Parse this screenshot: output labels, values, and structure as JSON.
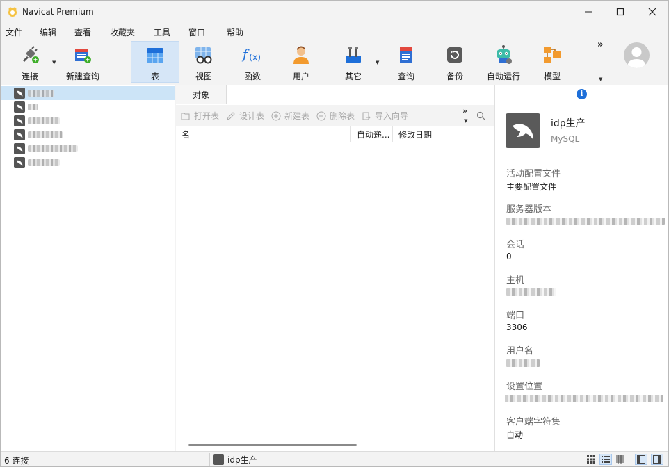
{
  "window": {
    "title": "Navicat Premium",
    "controls": [
      "minimize-icon",
      "maximize-icon",
      "close-icon"
    ]
  },
  "menu": [
    "文件",
    "编辑",
    "查看",
    "收藏夹",
    "工具",
    "窗口",
    "帮助"
  ],
  "toolbar": {
    "buttons": [
      {
        "label": "连接",
        "icon": "connect-plug-icon"
      },
      {
        "label": "新建查询",
        "icon": "new-query-icon"
      },
      {
        "label": "表",
        "icon": "table-icon",
        "active": true
      },
      {
        "label": "视图",
        "icon": "view-glasses-icon"
      },
      {
        "label": "函数",
        "icon": "function-fx-icon"
      },
      {
        "label": "用户",
        "icon": "user-icon"
      },
      {
        "label": "其它",
        "icon": "tools-icon"
      },
      {
        "label": "查询",
        "icon": "query-icon"
      },
      {
        "label": "备份",
        "icon": "backup-icon"
      },
      {
        "label": "自动运行",
        "icon": "robot-icon"
      },
      {
        "label": "模型",
        "icon": "model-icon"
      }
    ],
    "more": "»"
  },
  "sidebar": {
    "connections_count": 6
  },
  "center": {
    "tab_label": "对象",
    "actions": [
      "打开表",
      "设计表",
      "新建表",
      "删除表",
      "导入向导"
    ],
    "columns": [
      "名",
      "自动递...",
      "修改日期"
    ],
    "more": "»"
  },
  "info": {
    "name": "idp生产",
    "type": "MySQL",
    "profile_label": "活动配置文件",
    "profile_value": "主要配置文件",
    "server_version_label": "服务器版本",
    "sessions_label": "会话",
    "sessions_value": "0",
    "host_label": "主机",
    "port_label": "端口",
    "port_value": "3306",
    "username_label": "用户名",
    "settings_location_label": "设置位置",
    "charset_label": "客户端字符集",
    "charset_value": "自动"
  },
  "status": {
    "connections": "6 连接",
    "current_connection": "idp生产"
  }
}
